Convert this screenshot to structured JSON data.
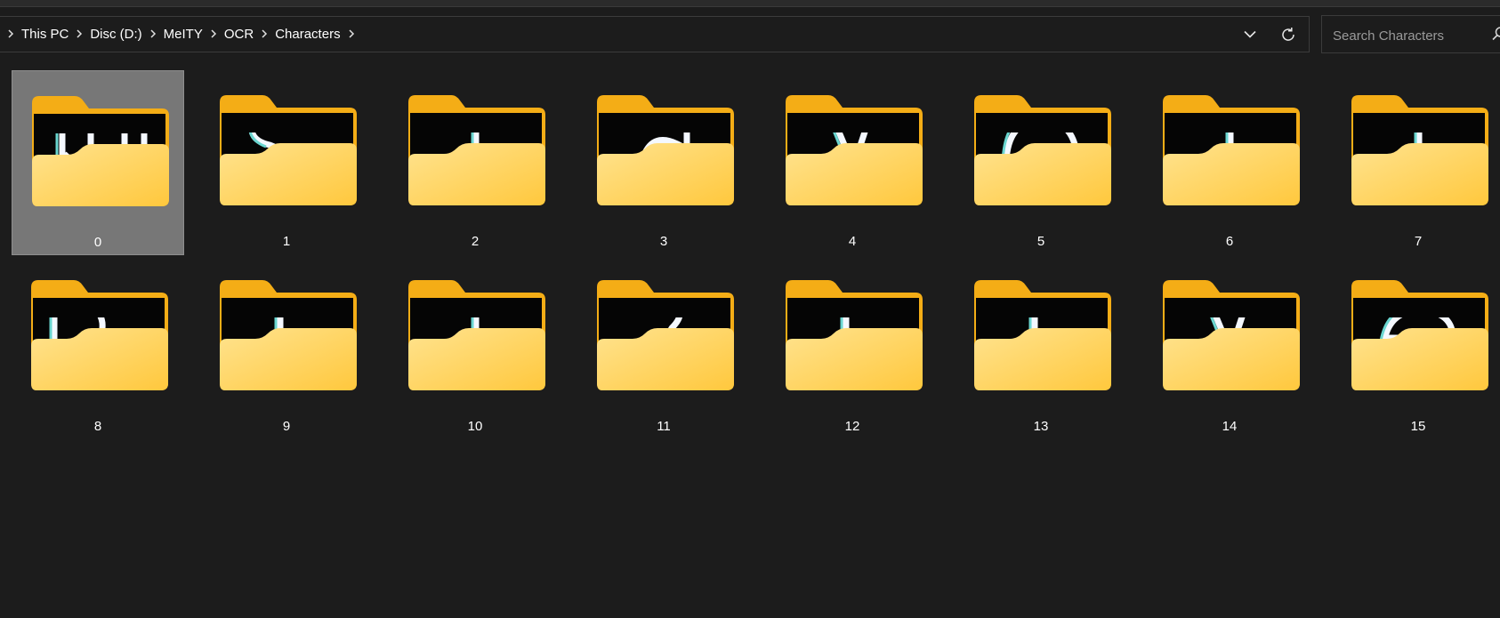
{
  "breadcrumb": {
    "items": [
      {
        "label": "This PC"
      },
      {
        "label": "Disc (D:)"
      },
      {
        "label": "MeITY"
      },
      {
        "label": "OCR"
      },
      {
        "label": "Characters"
      }
    ]
  },
  "search": {
    "placeholder": "Search Characters",
    "value": ""
  },
  "icons": {
    "history": "chevron-down-icon",
    "refresh": "refresh-icon",
    "search": "search-icon",
    "separator": "chevron-right-icon",
    "folder": "folder-icon"
  },
  "colors": {
    "background": "#1c1c1c",
    "selection": "#777777",
    "folder_back": "#f9b81e",
    "folder_front": "#ffd966"
  },
  "folders": [
    {
      "name": "0",
      "glyph": "u",
      "selected": true
    },
    {
      "name": "1",
      "glyph": "s",
      "selected": false
    },
    {
      "name": "2",
      "glyph": "t",
      "selected": false
    },
    {
      "name": "3",
      "glyph": "d",
      "selected": false
    },
    {
      "name": "4",
      "glyph": "v",
      "selected": false
    },
    {
      "name": "5",
      "glyph": "o",
      "selected": false
    },
    {
      "name": "6",
      "glyph": "i",
      "selected": false
    },
    {
      "name": "7",
      "glyph": "i",
      "selected": false
    },
    {
      "name": "8",
      "glyph": "p",
      "selected": false
    },
    {
      "name": "9",
      "glyph": "l",
      "selected": false
    },
    {
      "name": "10",
      "glyph": "i",
      "selected": false
    },
    {
      "name": "11",
      "glyph": "2",
      "selected": false
    },
    {
      "name": "12",
      "glyph": "l",
      "selected": false
    },
    {
      "name": "13",
      "glyph": "l",
      "selected": false
    },
    {
      "name": "14",
      "glyph": "v",
      "selected": false
    },
    {
      "name": "15",
      "glyph": "e",
      "selected": false
    }
  ]
}
